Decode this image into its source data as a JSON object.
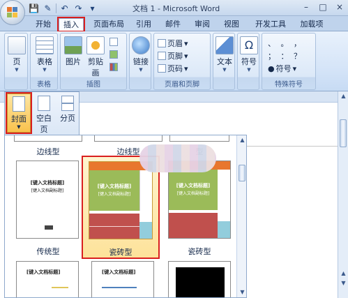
{
  "window": {
    "title": "文档 1 - Microsoft Word",
    "controls": [
      "–",
      "□",
      "×"
    ]
  },
  "quick_access": [
    "save-icon",
    "undo-icon",
    "redo-icon",
    "dropdown-icon"
  ],
  "tabs": [
    {
      "label": "开始"
    },
    {
      "label": "插入",
      "active": true
    },
    {
      "label": "页面布局"
    },
    {
      "label": "引用"
    },
    {
      "label": "邮件"
    },
    {
      "label": "审阅"
    },
    {
      "label": "视图"
    },
    {
      "label": "开发工具"
    },
    {
      "label": "加载项"
    }
  ],
  "ribbon": {
    "pages": {
      "button_label": "页"
    },
    "tables": {
      "group_label": "表格",
      "button_label": "表格"
    },
    "illustrations": {
      "group_label": "插图",
      "picture": "图片",
      "clipart": "剪贴画"
    },
    "links": {
      "button_label": "链接"
    },
    "header_footer": {
      "group_label": "页眉和页脚",
      "header": "页眉",
      "footer": "页脚",
      "page_number": "页码"
    },
    "text": {
      "button_label": "文本"
    },
    "symbols": {
      "button_label": "符号"
    },
    "special_symbols": {
      "group_label": "特殊符号",
      "row1": "、 。 ，",
      "row2": "； ： ？",
      "symbol_label": "符号"
    }
  },
  "page_dropdown": {
    "cover": "封面",
    "blank": "空白页",
    "break": "分页"
  },
  "gallery": {
    "row0": [
      "边线型",
      "边线型",
      "型"
    ],
    "row1": [
      {
        "label": "传统型",
        "title": "[键入文档标题]",
        "subtitle": "[键入文档副标题]"
      },
      {
        "label": "瓷砖型",
        "title": "[键入文档标题]",
        "subtitle": "[键入文档副标题]",
        "selected": true
      },
      {
        "label": "瓷砖型",
        "title": "[键入文档标题]",
        "subtitle": "[键入文档副标题]"
      }
    ],
    "row2": [
      {
        "title": "[键入文档标题]"
      },
      {
        "title": "[键入文档标题]"
      },
      {
        "title": ""
      }
    ]
  },
  "colors": {
    "highlight": "#d91f1f",
    "tile_orange": "#e8772e",
    "tile_green": "#9bbb59",
    "tile_red": "#c0504d",
    "tile_blue": "#92cddc"
  }
}
